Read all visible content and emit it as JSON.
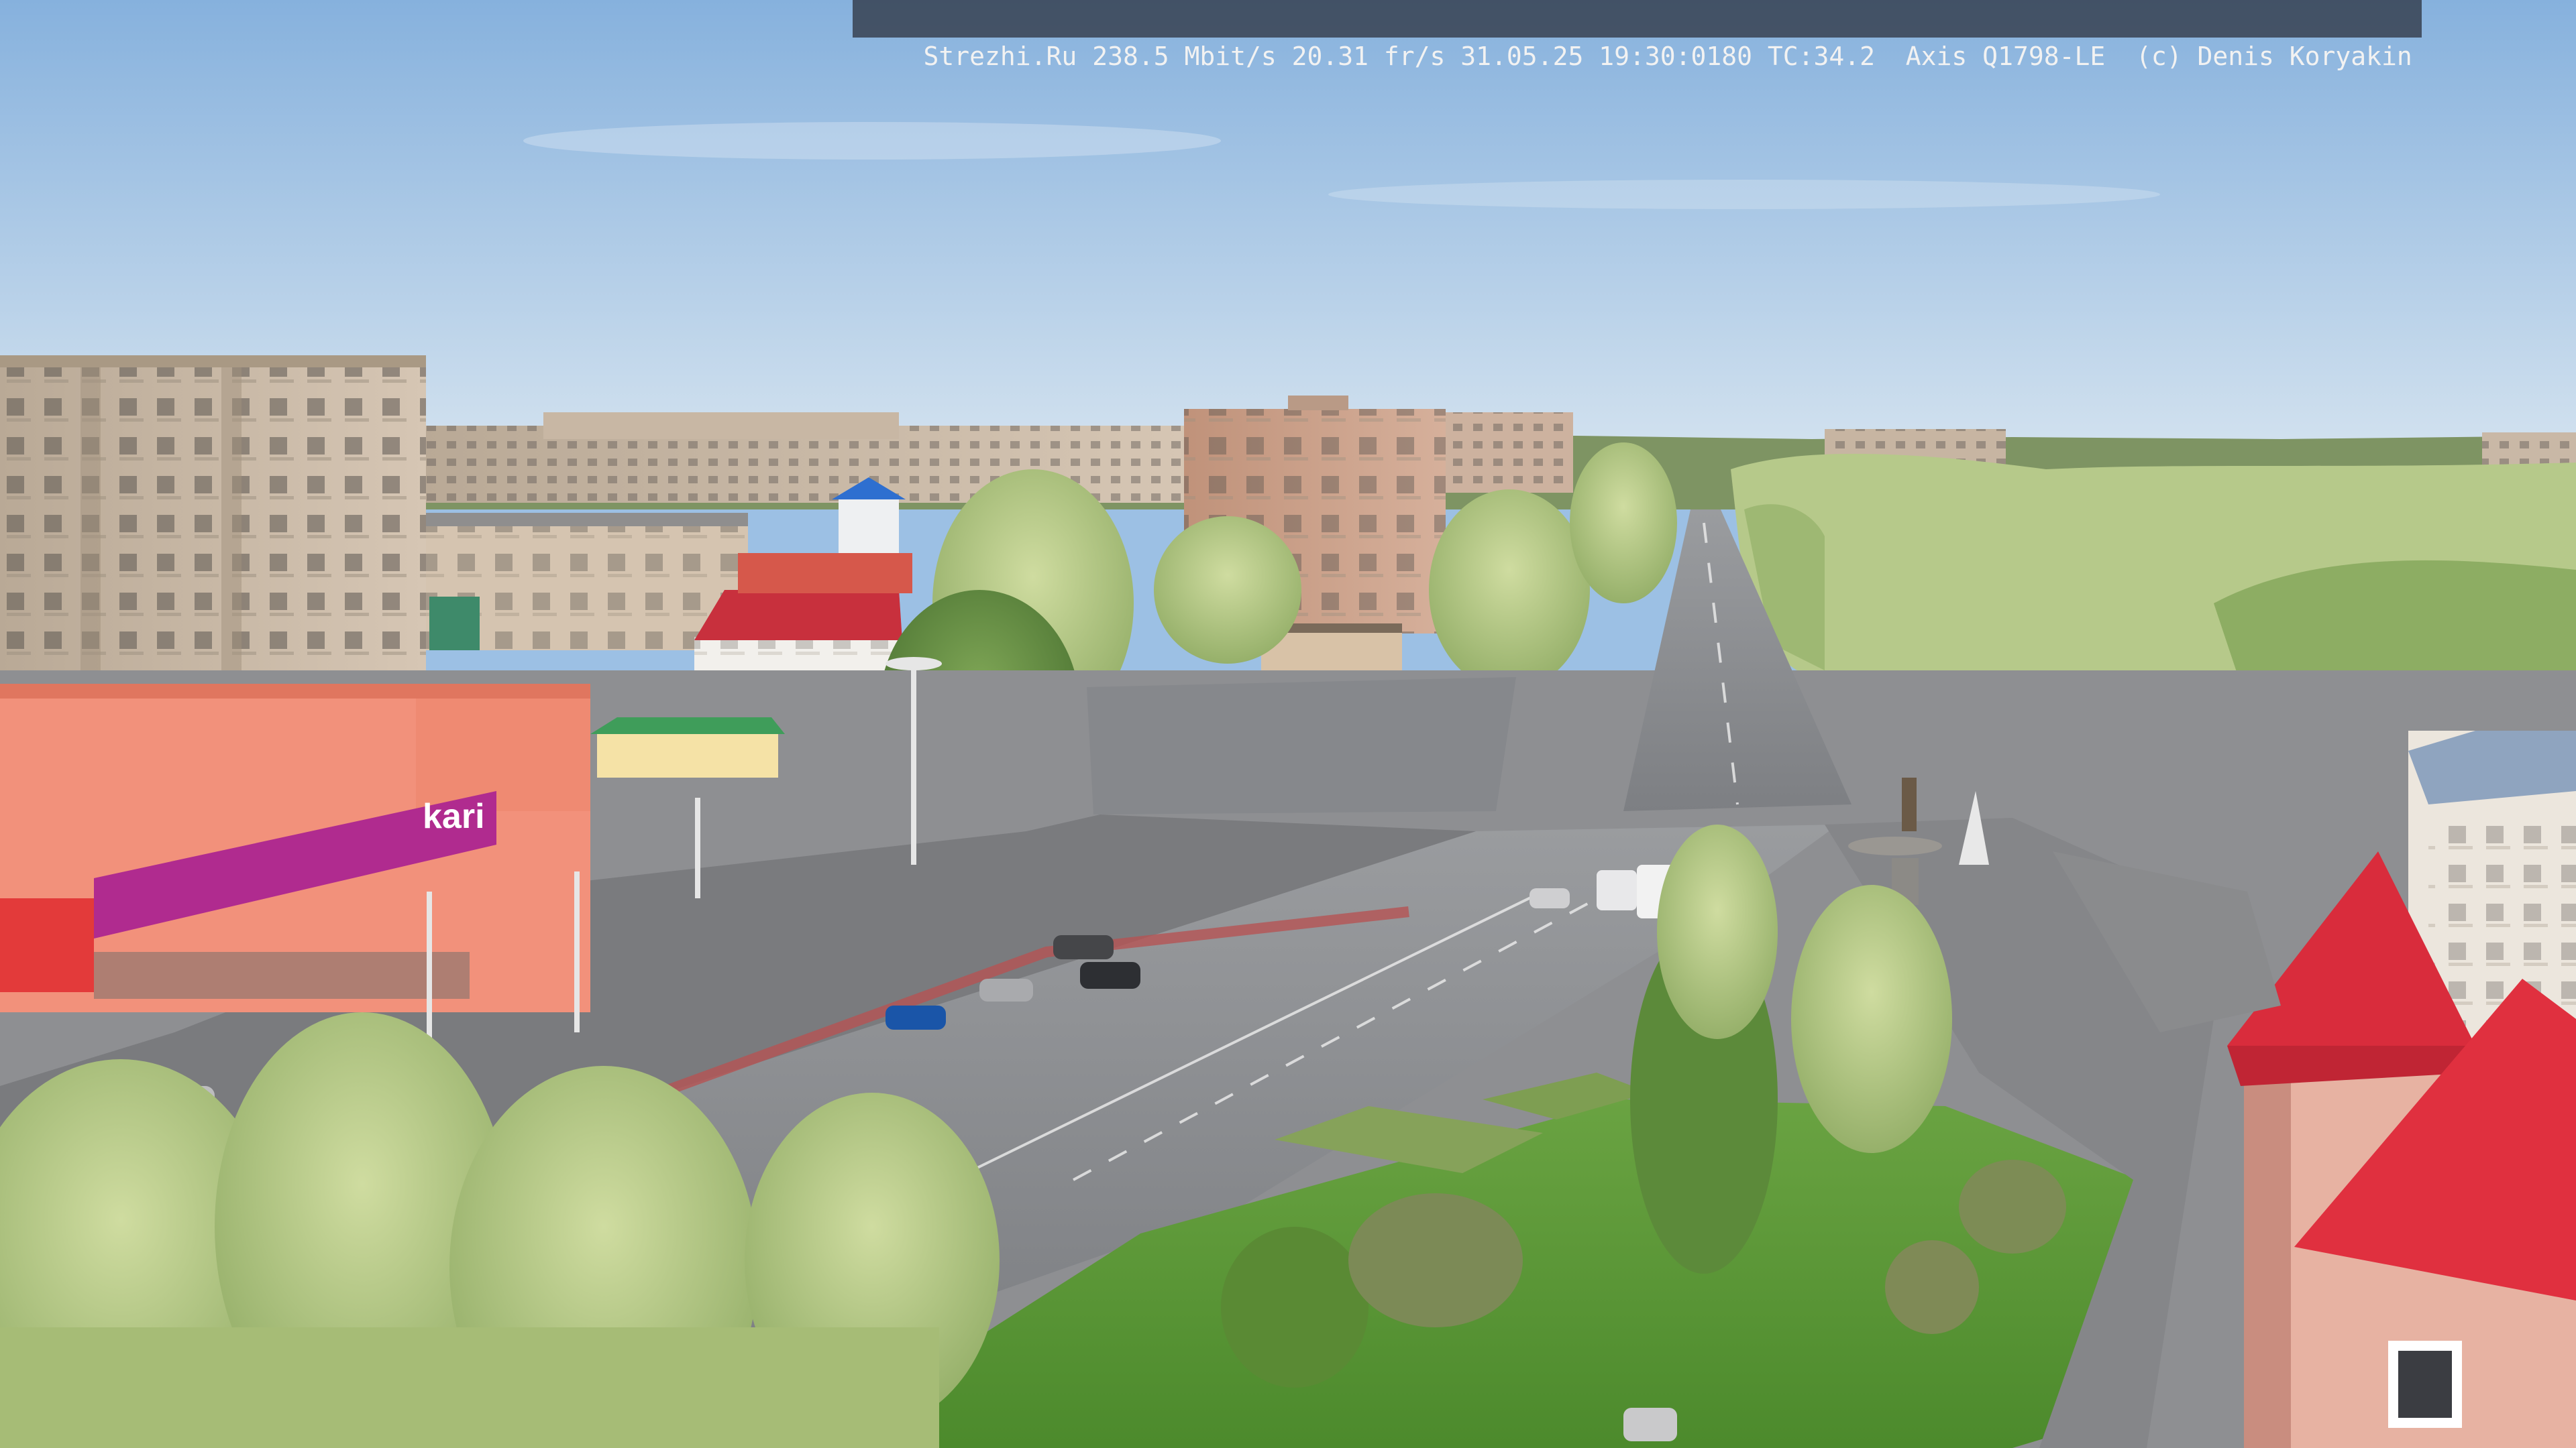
{
  "overlay": {
    "site": "Strezhi.Ru",
    "bitrate": "238.5 Mbit/s",
    "framerate": "20.31 fr/s",
    "timestamp": "31.05.25 19:30:0180",
    "tc": "TC:34.2",
    "camera": "Axis Q1798-LE",
    "credit": "(c) Denis Koryakin"
  },
  "signage": {
    "store_logo": "kari"
  },
  "colors": {
    "sky_top": "#8db6df",
    "sky_bottom": "#cfe0ef",
    "asphalt": "#8a8c90",
    "grass": "#5f9a3a",
    "tree_light": "#b7c987",
    "tree_dark": "#5f8a3d",
    "panel_building": "#c9b8a6",
    "brick_building": "#c99f86",
    "store_facade": "#f08a74",
    "store_banner": "#b02b8f",
    "red_roof": "#d92c3c",
    "overlay_bg": "#2c3038"
  }
}
